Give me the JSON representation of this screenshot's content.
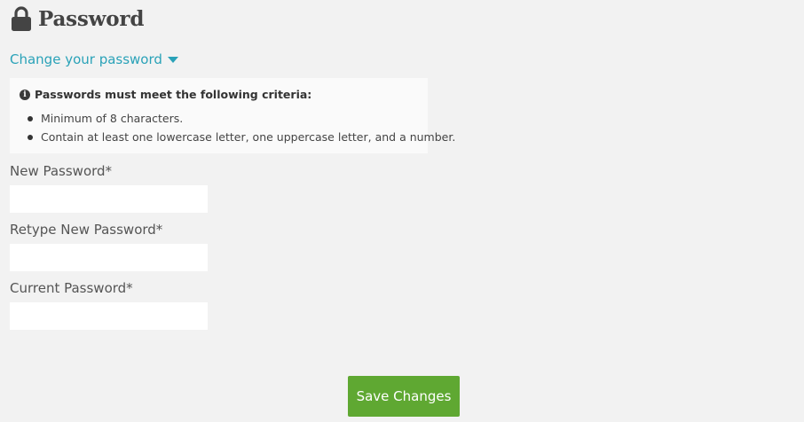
{
  "header": {
    "icon": "lock-icon",
    "title": "Password"
  },
  "toggle": {
    "label": "Change your password",
    "icon": "caret-down-icon",
    "color": "#2aa2b8"
  },
  "criteria": {
    "icon": "info-icon",
    "heading": "Passwords must meet the following criteria:",
    "items": [
      "Minimum of 8 characters.",
      "Contain at least one lowercase letter, one uppercase letter, and a number."
    ]
  },
  "fields": [
    {
      "label": "New Password*",
      "value": "",
      "type": "password"
    },
    {
      "label": "Retype New Password*",
      "value": "",
      "type": "password"
    },
    {
      "label": "Current Password*",
      "value": "",
      "type": "password"
    }
  ],
  "actions": {
    "save_label": "Save Changes",
    "save_color": "#5fa832"
  }
}
